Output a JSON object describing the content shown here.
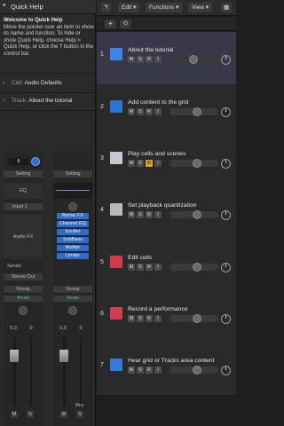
{
  "quick_help": {
    "title": "Quick Help",
    "heading": "Welcome to Quick Help",
    "body": "Move the pointer over an item to show its name and function. To hide or show Quick Help, choose Help > Quick Help, or click the ? button in the control bar."
  },
  "inspector": {
    "cell_label": "Cell:",
    "cell_value": "Audio Defaults",
    "track_label": "Track:",
    "track_value": "About the tutorial"
  },
  "strip1": {
    "value_box": "6",
    "setting": "Setting",
    "eq": "EQ",
    "input": "Input 1",
    "audio_fx": "Audio FX",
    "sends": "Sends",
    "output": "Stereo Out",
    "group": "Group",
    "automation": "Read",
    "volume": "0,0",
    "meter_value": "0",
    "m": "M",
    "s": "S"
  },
  "strip2": {
    "setting": "Setting",
    "plugins": [
      "Remix FX",
      "Channel EQ",
      "Exciter",
      "SubBass",
      "Multipr",
      "Limiter"
    ],
    "group": "Group",
    "automation": "Read",
    "volume": "0,0",
    "meter_value": "0",
    "bounce": "Bnc",
    "m": "M",
    "s": "S"
  },
  "toolbar": {
    "edit": "Edit",
    "functions": "Functions",
    "view": "View",
    "add": "+"
  },
  "tracks": [
    {
      "num": "1",
      "name": "About the tutorial",
      "icon_color": "#3d86e8",
      "buttons": [
        "M",
        "S",
        "R",
        "I"
      ]
    },
    {
      "num": "2",
      "name": "Add content to the grid",
      "icon_color": "#2f72d6",
      "buttons": [
        "M",
        "S",
        "R",
        "I"
      ]
    },
    {
      "num": "3",
      "name": "Play cells and scenes",
      "icon_color": "#c8c8d2",
      "buttons": [
        "M",
        "S",
        "R",
        "I"
      ]
    },
    {
      "num": "4",
      "name": "Set playback quantization",
      "icon_color": "#b8b8bf",
      "buttons": [
        "M",
        "S",
        "R",
        "I"
      ]
    },
    {
      "num": "5",
      "name": "Edit cells",
      "icon_color": "#d43a4a",
      "buttons": [
        "M",
        "S",
        "R",
        "I"
      ]
    },
    {
      "num": "6",
      "name": "Record a performance",
      "icon_color": "#cf3f52",
      "buttons": [
        "M",
        "S",
        "R",
        "I"
      ]
    },
    {
      "num": "7",
      "name": "Hear grid or Tracks area content",
      "icon_color": "#3479dc",
      "buttons": [
        "M",
        "S",
        "R",
        "I"
      ]
    }
  ],
  "colors": {
    "selected_track": "#38384a",
    "plugin_blue": "#2e6ccc",
    "read_green": "#52c563",
    "record_yellow": "#d8a22a"
  }
}
